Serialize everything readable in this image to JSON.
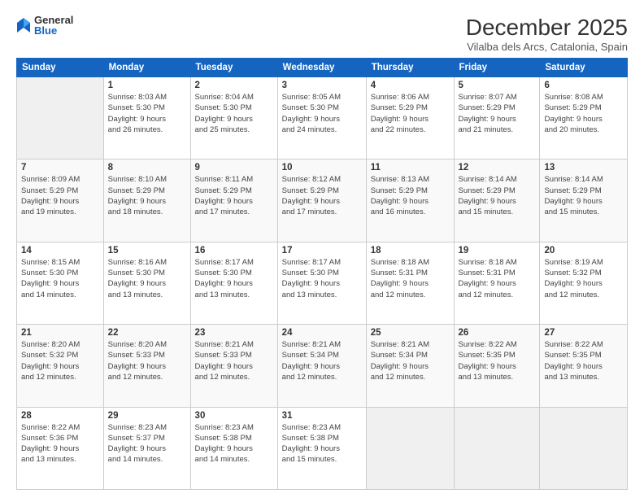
{
  "logo": {
    "general": "General",
    "blue": "Blue"
  },
  "header": {
    "month": "December 2025",
    "location": "Vilalba dels Arcs, Catalonia, Spain"
  },
  "weekdays": [
    "Sunday",
    "Monday",
    "Tuesday",
    "Wednesday",
    "Thursday",
    "Friday",
    "Saturday"
  ],
  "weeks": [
    [
      {
        "day": "",
        "info": ""
      },
      {
        "day": "1",
        "info": "Sunrise: 8:03 AM\nSunset: 5:30 PM\nDaylight: 9 hours\nand 26 minutes."
      },
      {
        "day": "2",
        "info": "Sunrise: 8:04 AM\nSunset: 5:30 PM\nDaylight: 9 hours\nand 25 minutes."
      },
      {
        "day": "3",
        "info": "Sunrise: 8:05 AM\nSunset: 5:30 PM\nDaylight: 9 hours\nand 24 minutes."
      },
      {
        "day": "4",
        "info": "Sunrise: 8:06 AM\nSunset: 5:29 PM\nDaylight: 9 hours\nand 22 minutes."
      },
      {
        "day": "5",
        "info": "Sunrise: 8:07 AM\nSunset: 5:29 PM\nDaylight: 9 hours\nand 21 minutes."
      },
      {
        "day": "6",
        "info": "Sunrise: 8:08 AM\nSunset: 5:29 PM\nDaylight: 9 hours\nand 20 minutes."
      }
    ],
    [
      {
        "day": "7",
        "info": "Sunrise: 8:09 AM\nSunset: 5:29 PM\nDaylight: 9 hours\nand 19 minutes."
      },
      {
        "day": "8",
        "info": "Sunrise: 8:10 AM\nSunset: 5:29 PM\nDaylight: 9 hours\nand 18 minutes."
      },
      {
        "day": "9",
        "info": "Sunrise: 8:11 AM\nSunset: 5:29 PM\nDaylight: 9 hours\nand 17 minutes."
      },
      {
        "day": "10",
        "info": "Sunrise: 8:12 AM\nSunset: 5:29 PM\nDaylight: 9 hours\nand 17 minutes."
      },
      {
        "day": "11",
        "info": "Sunrise: 8:13 AM\nSunset: 5:29 PM\nDaylight: 9 hours\nand 16 minutes."
      },
      {
        "day": "12",
        "info": "Sunrise: 8:14 AM\nSunset: 5:29 PM\nDaylight: 9 hours\nand 15 minutes."
      },
      {
        "day": "13",
        "info": "Sunrise: 8:14 AM\nSunset: 5:29 PM\nDaylight: 9 hours\nand 15 minutes."
      }
    ],
    [
      {
        "day": "14",
        "info": "Sunrise: 8:15 AM\nSunset: 5:30 PM\nDaylight: 9 hours\nand 14 minutes."
      },
      {
        "day": "15",
        "info": "Sunrise: 8:16 AM\nSunset: 5:30 PM\nDaylight: 9 hours\nand 13 minutes."
      },
      {
        "day": "16",
        "info": "Sunrise: 8:17 AM\nSunset: 5:30 PM\nDaylight: 9 hours\nand 13 minutes."
      },
      {
        "day": "17",
        "info": "Sunrise: 8:17 AM\nSunset: 5:30 PM\nDaylight: 9 hours\nand 13 minutes."
      },
      {
        "day": "18",
        "info": "Sunrise: 8:18 AM\nSunset: 5:31 PM\nDaylight: 9 hours\nand 12 minutes."
      },
      {
        "day": "19",
        "info": "Sunrise: 8:18 AM\nSunset: 5:31 PM\nDaylight: 9 hours\nand 12 minutes."
      },
      {
        "day": "20",
        "info": "Sunrise: 8:19 AM\nSunset: 5:32 PM\nDaylight: 9 hours\nand 12 minutes."
      }
    ],
    [
      {
        "day": "21",
        "info": "Sunrise: 8:20 AM\nSunset: 5:32 PM\nDaylight: 9 hours\nand 12 minutes."
      },
      {
        "day": "22",
        "info": "Sunrise: 8:20 AM\nSunset: 5:33 PM\nDaylight: 9 hours\nand 12 minutes."
      },
      {
        "day": "23",
        "info": "Sunrise: 8:21 AM\nSunset: 5:33 PM\nDaylight: 9 hours\nand 12 minutes."
      },
      {
        "day": "24",
        "info": "Sunrise: 8:21 AM\nSunset: 5:34 PM\nDaylight: 9 hours\nand 12 minutes."
      },
      {
        "day": "25",
        "info": "Sunrise: 8:21 AM\nSunset: 5:34 PM\nDaylight: 9 hours\nand 12 minutes."
      },
      {
        "day": "26",
        "info": "Sunrise: 8:22 AM\nSunset: 5:35 PM\nDaylight: 9 hours\nand 13 minutes."
      },
      {
        "day": "27",
        "info": "Sunrise: 8:22 AM\nSunset: 5:35 PM\nDaylight: 9 hours\nand 13 minutes."
      }
    ],
    [
      {
        "day": "28",
        "info": "Sunrise: 8:22 AM\nSunset: 5:36 PM\nDaylight: 9 hours\nand 13 minutes."
      },
      {
        "day": "29",
        "info": "Sunrise: 8:23 AM\nSunset: 5:37 PM\nDaylight: 9 hours\nand 14 minutes."
      },
      {
        "day": "30",
        "info": "Sunrise: 8:23 AM\nSunset: 5:38 PM\nDaylight: 9 hours\nand 14 minutes."
      },
      {
        "day": "31",
        "info": "Sunrise: 8:23 AM\nSunset: 5:38 PM\nDaylight: 9 hours\nand 15 minutes."
      },
      {
        "day": "",
        "info": ""
      },
      {
        "day": "",
        "info": ""
      },
      {
        "day": "",
        "info": ""
      }
    ]
  ]
}
